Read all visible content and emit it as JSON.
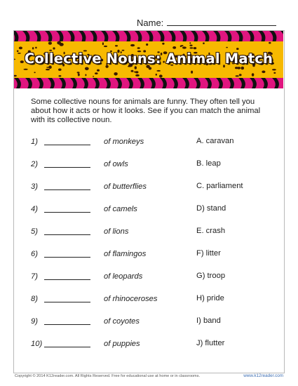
{
  "header": {
    "name_label": "Name:"
  },
  "banner": {
    "title": "Collective Nouns: Animal Match"
  },
  "instructions": "Some collective nouns for animals are funny. They often tell you about how it acts or how it looks. See if you can match the animal with its collective noun.",
  "questions": [
    {
      "num": "1)",
      "animal": "of monkeys",
      "choice": "A. caravan"
    },
    {
      "num": "2)",
      "animal": "of owls",
      "choice": "B. leap"
    },
    {
      "num": "3)",
      "animal": "of butterflies",
      "choice": "C. parliament"
    },
    {
      "num": "4)",
      "animal": "of camels",
      "choice": "D) stand"
    },
    {
      "num": "5)",
      "animal": "of lions",
      "choice": "E. crash"
    },
    {
      "num": "6)",
      "animal": "of flamingos",
      "choice": "F) litter"
    },
    {
      "num": "7)",
      "animal": "of leopards",
      "choice": "G) troop"
    },
    {
      "num": "8)",
      "animal": "of rhinoceroses",
      "choice": "H) pride"
    },
    {
      "num": "9)",
      "animal": "of coyotes",
      "choice": "I) band"
    },
    {
      "num": "10)",
      "animal": "of puppies",
      "choice": "J) flutter"
    }
  ],
  "footer": {
    "copyright": "Copyright © 2014 K12reader.com. All Rights Reserved. Free for educational use at home or in classrooms.",
    "site": "www.k12reader.com"
  },
  "colors": {
    "zebra_pink": "#e0157f",
    "leopard_yellow": "#f7b900",
    "spot_dark": "#3a1a00"
  }
}
